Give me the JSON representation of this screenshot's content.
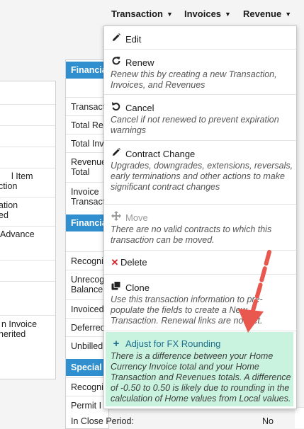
{
  "nav": {
    "transaction": "Transaction",
    "invoices": "Invoices",
    "revenue": "Revenue"
  },
  "left_panel": {
    "rows": [
      "l Item",
      "ction",
      "ation",
      "ed",
      "Advance",
      "n Invoice",
      "herited"
    ]
  },
  "mid_panel": {
    "header1": "Financia",
    "rows1": [
      "Transact",
      "Total Re",
      "Total Inv",
      "Revenue\nTotal",
      "Invoice\nTransact"
    ],
    "header2": "Financia",
    "rows2": [
      "Recogni",
      "Unrecog\nBalance",
      "Invoiced",
      "Deferred",
      "Unbilled"
    ],
    "header3": "Special",
    "rows3": [
      "Recogni",
      "Permit I"
    ]
  },
  "bottom": {
    "label": "In Close Period:",
    "value": "No"
  },
  "menu": {
    "edit": "Edit",
    "renew": "Renew",
    "renew_desc": "Renew this by creating a new Transaction, Invoices, and Revenues",
    "cancel": "Cancel",
    "cancel_desc": "Cancel if not renewed to prevent expiration warnings",
    "contract_change": "Contract Change",
    "contract_change_desc": "Upgrades, downgrades, extensions, reversals, early terminations and other actions to make significant contract changes",
    "move": "Move",
    "move_desc": "There are no valid contracts to which this transaction can be moved.",
    "delete": "Delete",
    "clone": "Clone",
    "clone_desc": "Use this transaction information to pre-populate the fields to create a New Transaction. Renewal links are not set.",
    "fx": "Adjust for FX Rounding",
    "fx_desc": "There is a difference between your Home Currency Invoice total and your Home Transaction and Revenues totals. A difference of -0.50 to 0.50 is likely due to rounding in the calculation of Home values from Local values."
  },
  "colors": {
    "header_blue": "#2f8fcf",
    "highlight_green": "#c9f3df",
    "delete_red": "#d0242b",
    "arrow_red": "#e8584e"
  },
  "icons": {
    "edit": "pencil-icon",
    "renew": "renew-icon",
    "cancel": "undo-icon",
    "contract_change": "pencil-icon",
    "move": "move-arrows-icon",
    "delete": "x-icon",
    "clone": "clone-icon",
    "fx": "plus-icon"
  }
}
